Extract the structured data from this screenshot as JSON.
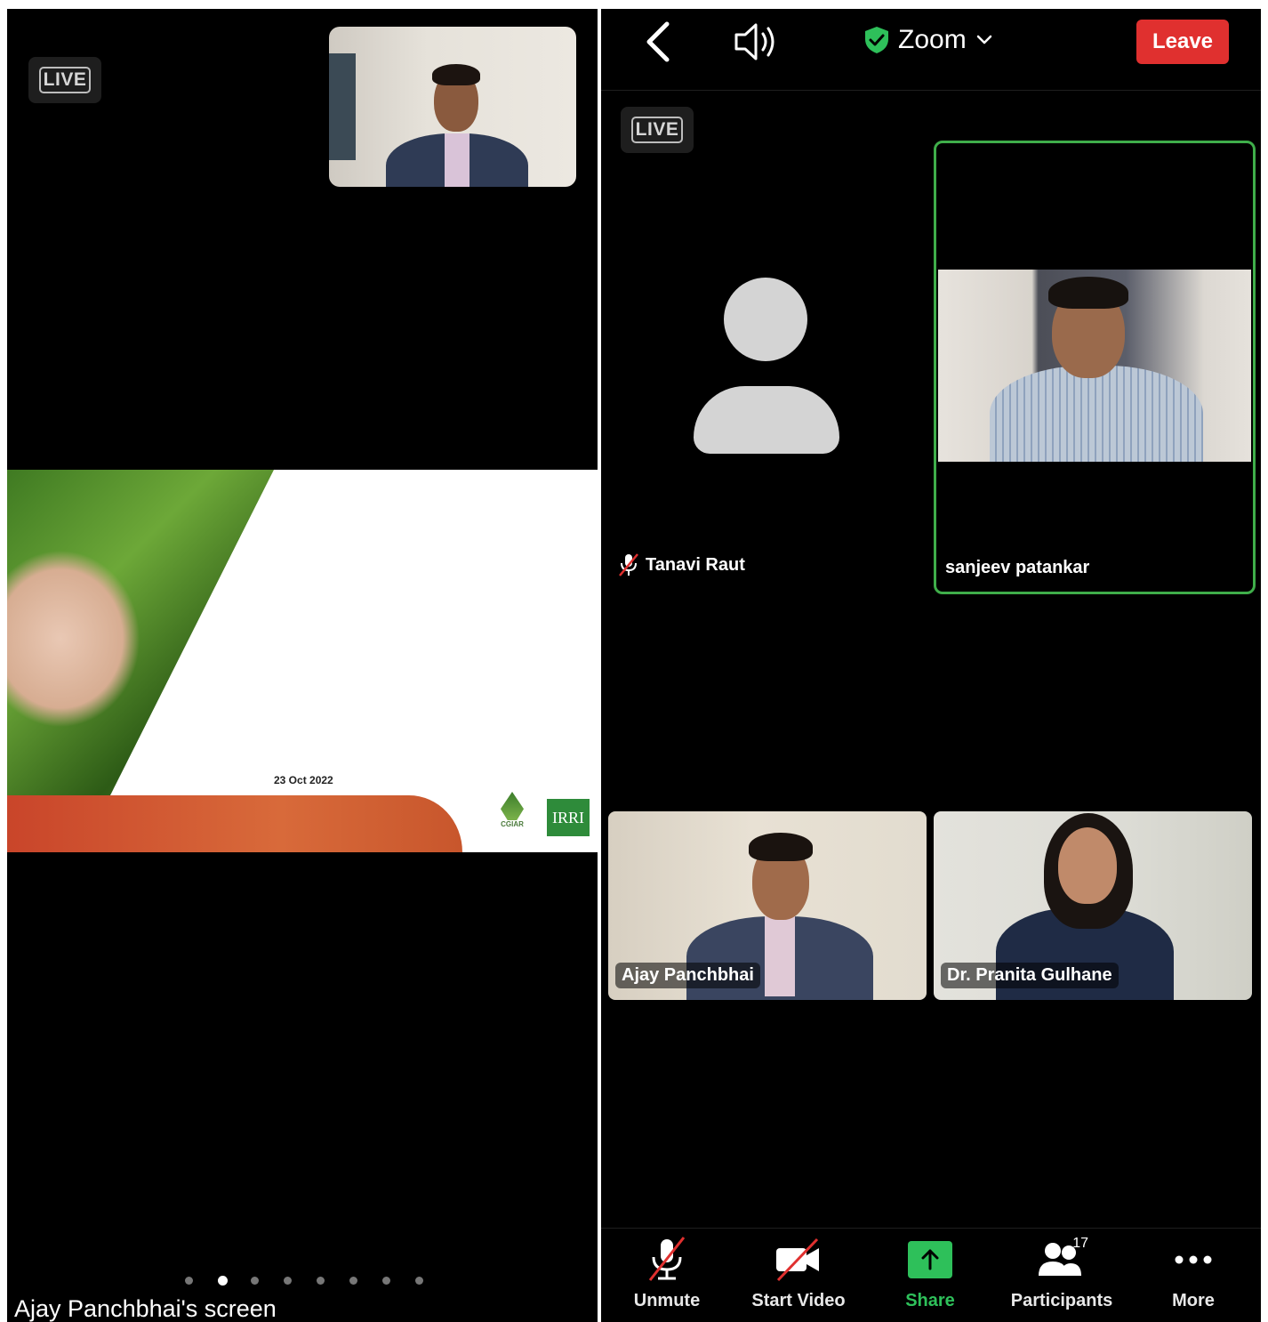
{
  "left": {
    "live_badge": "LIVE",
    "slide": {
      "date": "23 Oct 2022",
      "logo_cgiar": "CGIAR",
      "logo_irri": "IRRI"
    },
    "screen_label": "Ajay Panchbhai's screen",
    "page_dots": 8,
    "active_dot": 1
  },
  "header": {
    "back_icon": "chevron-left-icon",
    "speaker_icon": "speaker-icon",
    "shield_icon": "shield-check-icon",
    "title": "Zoom",
    "dropdown_icon": "chevron-down-icon",
    "leave_label": "Leave"
  },
  "right": {
    "live_badge": "LIVE"
  },
  "participants": {
    "tanavi": "Tanavi Raut",
    "sanjeev": "sanjeev patankar",
    "ajay": "Ajay Panchbhai",
    "pranita": "Dr. Pranita Gulhane"
  },
  "toolbar": {
    "unmute": "Unmute",
    "start_video": "Start Video",
    "share": "Share",
    "participants": "Participants",
    "participants_count": "17",
    "more": "More"
  },
  "colors": {
    "active_speaker_border": "#3fae4a",
    "leave": "#e0302f",
    "share_green": "#2ec05a",
    "irri_green": "#2e8b3a"
  }
}
